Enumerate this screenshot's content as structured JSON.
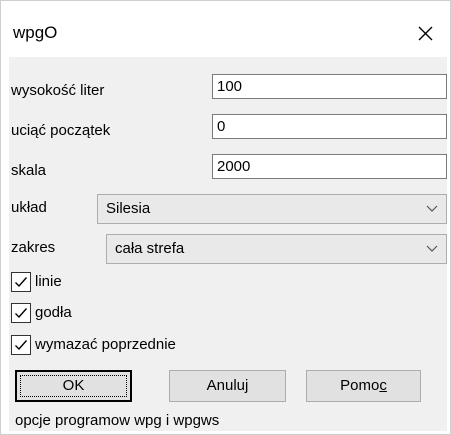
{
  "window": {
    "title": "wpgO"
  },
  "fields": {
    "letter_height": {
      "label": "wysokość liter",
      "value": "100"
    },
    "trim_start": {
      "label": "uciąć początek",
      "value": "0"
    },
    "scale": {
      "label": "skala",
      "value": "2000"
    }
  },
  "layout_select": {
    "label": "układ",
    "selected": "Silesia"
  },
  "range_select": {
    "label": "zakres",
    "selected": "cała strefa"
  },
  "checkboxes": [
    {
      "label": "linie",
      "checked": true
    },
    {
      "label": "godła",
      "checked": true
    },
    {
      "label": "wymazać poprzednie",
      "checked": true
    }
  ],
  "buttons": {
    "ok": "OK",
    "cancel": "Anuluj",
    "help_prefix": "Pomo",
    "help_accel": "c"
  },
  "status_text": "opcje programow wpg i wpgws",
  "colors": {
    "client_bg": "#f0f0f0",
    "button_bg": "#e1e1e1",
    "combo_bg": "#e9e9e9"
  }
}
